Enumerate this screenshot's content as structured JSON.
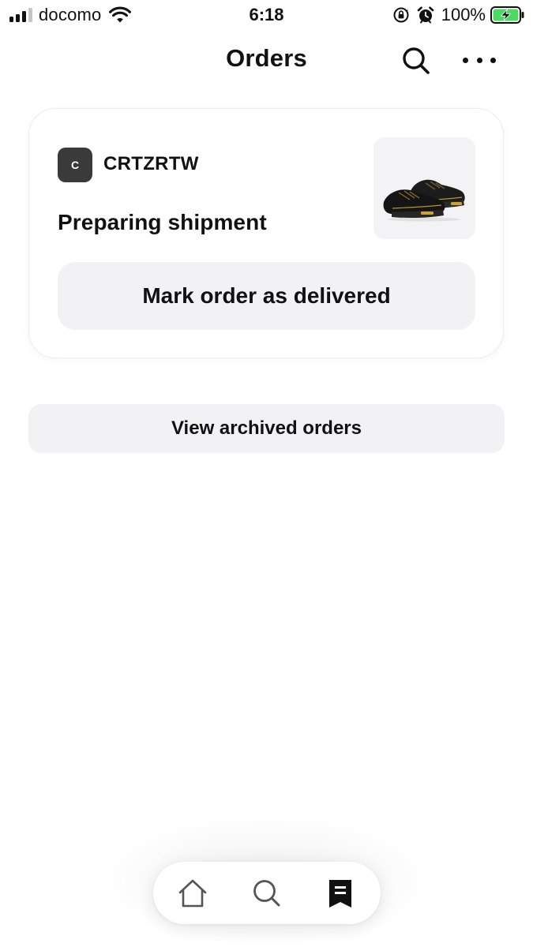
{
  "status_bar": {
    "carrier": "docomo",
    "time": "6:18",
    "battery_percent": "100%",
    "icons": [
      "signal-icon",
      "wifi-icon",
      "rotation-lock-icon",
      "alarm-icon",
      "battery-charging-icon"
    ]
  },
  "header": {
    "title": "Orders",
    "actions": [
      "search-icon",
      "more-icon"
    ]
  },
  "order": {
    "seller_initial": "C",
    "seller_name": "CRTZRTW",
    "status": "Preparing shipment",
    "product_image": "black-sneaker-image",
    "action_label": "Mark order as delivered"
  },
  "archived": {
    "label": "View archived orders"
  },
  "bottom_nav": {
    "items": [
      {
        "icon": "home-icon",
        "active": false
      },
      {
        "icon": "search-icon",
        "active": false
      },
      {
        "icon": "receipt-icon",
        "active": true
      }
    ]
  },
  "colors": {
    "background": "#ffffff",
    "button_fill": "#f2f2f4",
    "text": "#111111",
    "battery_green": "#4cd964",
    "avatar": "#3a3a3a"
  }
}
